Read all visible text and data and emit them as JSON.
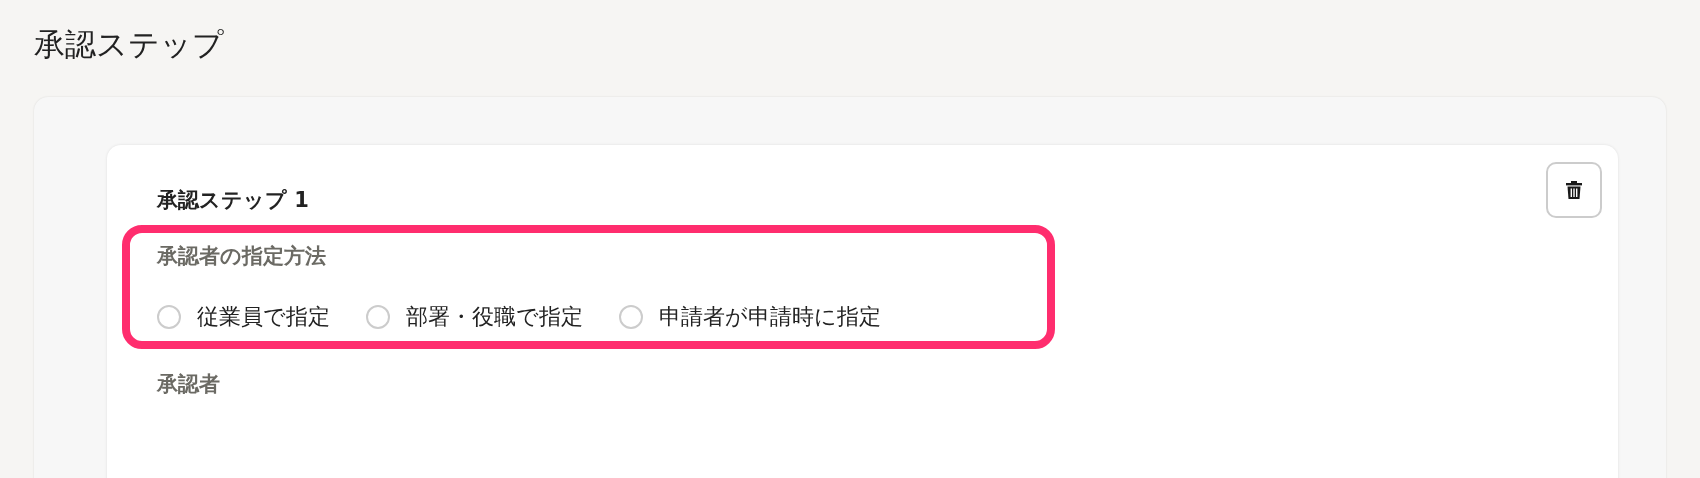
{
  "page_title": "承認ステップ",
  "step": {
    "title": "承認ステップ 1",
    "method": {
      "label": "承認者の指定方法",
      "options": [
        {
          "label": "従業員で指定",
          "selected": false
        },
        {
          "label": "部署・役職で指定",
          "selected": false
        },
        {
          "label": "申請者が申請時に指定",
          "selected": false
        }
      ]
    },
    "approver": {
      "label": "承認者"
    }
  }
}
